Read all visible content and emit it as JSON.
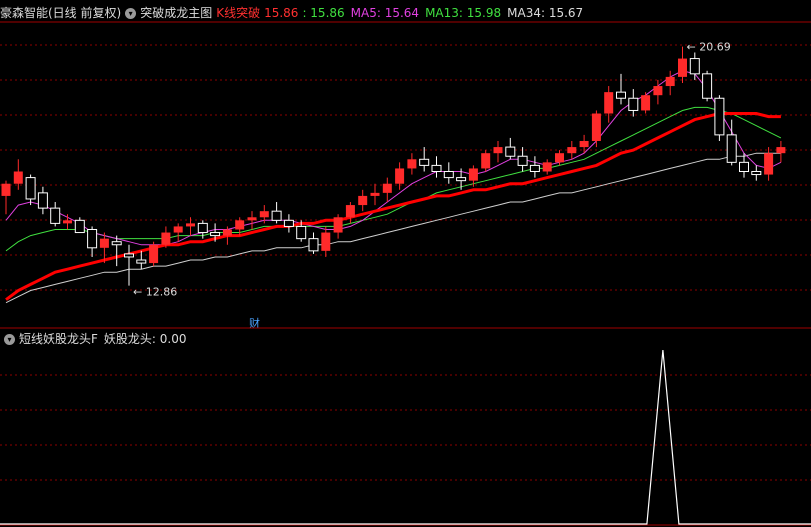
{
  "main_header": {
    "app_prefix": "豪森智能(日线 前复权)",
    "indicator_title": "突破成龙主图",
    "k_label": "K线突破",
    "k_value": "15.86",
    "k_value2": ": 15.86",
    "ma5_label": "MA5: 15.64",
    "ma13_label": "MA13: 15.98",
    "ma34_label": "MA34: 15.67"
  },
  "sub_header": {
    "indicator_title": "短线妖股龙头F",
    "value_label": "妖股龙头: 0.00"
  },
  "annotations": {
    "high": "20.69",
    "low": "12.86",
    "badge": "财"
  },
  "colors": {
    "up": "#ff2a2a",
    "down": "#ffffff",
    "ma5": "#e040e0",
    "ma13": "#40e040",
    "ma34": "#cfcfcf",
    "trend": "#ff0000",
    "grid": "#8b0000"
  },
  "chart_data": {
    "type": "candlestick",
    "candles": [
      [
        15.8,
        16.3,
        15.2,
        16.2
      ],
      [
        16.2,
        17.0,
        16.0,
        16.6
      ],
      [
        16.4,
        16.5,
        15.5,
        15.7
      ],
      [
        15.9,
        16.1,
        15.2,
        15.4
      ],
      [
        15.4,
        15.6,
        14.8,
        14.9
      ],
      [
        14.9,
        15.2,
        14.7,
        15.0
      ],
      [
        15.0,
        15.1,
        14.6,
        14.6
      ],
      [
        14.7,
        14.8,
        13.8,
        14.1
      ],
      [
        14.1,
        14.6,
        13.6,
        14.4
      ],
      [
        14.3,
        14.5,
        13.5,
        14.2
      ],
      [
        13.9,
        14.2,
        12.86,
        13.8
      ],
      [
        13.7,
        14.0,
        13.4,
        13.6
      ],
      [
        13.6,
        14.3,
        13.5,
        14.2
      ],
      [
        14.2,
        14.8,
        14.1,
        14.6
      ],
      [
        14.6,
        14.9,
        14.3,
        14.8
      ],
      [
        14.8,
        15.1,
        14.5,
        14.9
      ],
      [
        14.9,
        15.0,
        14.4,
        14.6
      ],
      [
        14.6,
        14.9,
        14.3,
        14.5
      ],
      [
        14.5,
        14.8,
        14.2,
        14.7
      ],
      [
        14.7,
        15.1,
        14.5,
        15.0
      ],
      [
        15.0,
        15.3,
        14.7,
        15.1
      ],
      [
        15.1,
        15.5,
        14.9,
        15.3
      ],
      [
        15.3,
        15.6,
        14.9,
        15.0
      ],
      [
        15.0,
        15.2,
        14.6,
        14.8
      ],
      [
        14.8,
        15.0,
        14.3,
        14.4
      ],
      [
        14.4,
        14.6,
        13.9,
        14.0
      ],
      [
        14.0,
        14.8,
        13.8,
        14.6
      ],
      [
        14.6,
        15.2,
        14.4,
        15.1
      ],
      [
        15.1,
        15.6,
        14.9,
        15.5
      ],
      [
        15.5,
        16.0,
        15.3,
        15.8
      ],
      [
        15.8,
        16.2,
        15.5,
        15.9
      ],
      [
        15.9,
        16.4,
        15.6,
        16.2
      ],
      [
        16.2,
        16.9,
        16.0,
        16.7
      ],
      [
        16.7,
        17.2,
        16.5,
        17.0
      ],
      [
        17.0,
        17.4,
        16.6,
        16.8
      ],
      [
        16.8,
        17.1,
        16.4,
        16.6
      ],
      [
        16.6,
        16.9,
        16.2,
        16.4
      ],
      [
        16.4,
        16.7,
        16.0,
        16.3
      ],
      [
        16.3,
        16.8,
        16.1,
        16.7
      ],
      [
        16.7,
        17.3,
        16.6,
        17.2
      ],
      [
        17.2,
        17.6,
        16.9,
        17.4
      ],
      [
        17.4,
        17.7,
        17.0,
        17.1
      ],
      [
        17.1,
        17.4,
        16.6,
        16.8
      ],
      [
        16.8,
        17.1,
        16.4,
        16.6
      ],
      [
        16.6,
        17.0,
        16.5,
        16.9
      ],
      [
        16.9,
        17.3,
        16.8,
        17.2
      ],
      [
        17.2,
        17.6,
        17.0,
        17.4
      ],
      [
        17.4,
        17.8,
        17.2,
        17.6
      ],
      [
        17.6,
        18.6,
        17.4,
        18.5
      ],
      [
        18.5,
        19.4,
        18.2,
        19.2
      ],
      [
        19.2,
        19.8,
        18.8,
        19.0
      ],
      [
        19.0,
        19.3,
        18.4,
        18.6
      ],
      [
        18.6,
        19.2,
        18.5,
        19.1
      ],
      [
        19.1,
        19.6,
        18.8,
        19.4
      ],
      [
        19.4,
        19.9,
        19.1,
        19.7
      ],
      [
        19.7,
        20.69,
        19.5,
        20.3
      ],
      [
        20.3,
        20.5,
        19.6,
        19.8
      ],
      [
        19.8,
        19.9,
        18.9,
        19.0
      ],
      [
        19.0,
        19.1,
        17.6,
        17.8
      ],
      [
        17.8,
        18.3,
        16.8,
        16.9
      ],
      [
        16.9,
        17.2,
        16.4,
        16.6
      ],
      [
        16.6,
        16.8,
        16.3,
        16.5
      ],
      [
        16.5,
        17.4,
        16.3,
        17.2
      ],
      [
        17.2,
        17.6,
        16.9,
        17.4
      ]
    ],
    "ma5": [
      15.0,
      15.5,
      15.6,
      15.5,
      15.3,
      15.1,
      14.9,
      14.6,
      14.5,
      14.4,
      14.3,
      14.2,
      14.2,
      14.2,
      14.3,
      14.5,
      14.6,
      14.7,
      14.7,
      14.8,
      14.9,
      15.0,
      15.0,
      15.0,
      14.9,
      14.8,
      14.7,
      14.7,
      14.8,
      15.0,
      15.3,
      15.6,
      15.9,
      16.2,
      16.4,
      16.6,
      16.6,
      16.6,
      16.5,
      16.6,
      16.8,
      17.0,
      17.0,
      16.9,
      16.8,
      16.9,
      17.0,
      17.2,
      17.6,
      18.1,
      18.6,
      18.9,
      19.1,
      19.4,
      19.7,
      19.9,
      19.8,
      19.3,
      18.6,
      17.9,
      17.2,
      16.8,
      16.7,
      16.9
    ],
    "ma13": [
      14.0,
      14.3,
      14.5,
      14.6,
      14.7,
      14.7,
      14.7,
      14.6,
      14.5,
      14.4,
      14.4,
      14.4,
      14.4,
      14.4,
      14.5,
      14.5,
      14.5,
      14.6,
      14.6,
      14.6,
      14.7,
      14.8,
      14.8,
      14.8,
      14.8,
      14.8,
      14.8,
      14.8,
      14.9,
      15.0,
      15.1,
      15.2,
      15.4,
      15.6,
      15.7,
      15.9,
      16.0,
      16.1,
      16.2,
      16.3,
      16.4,
      16.5,
      16.6,
      16.7,
      16.7,
      16.8,
      16.9,
      17.0,
      17.2,
      17.4,
      17.6,
      17.8,
      18.0,
      18.2,
      18.4,
      18.6,
      18.7,
      18.7,
      18.6,
      18.5,
      18.3,
      18.1,
      17.9,
      17.7
    ],
    "ma34": [
      12.3,
      12.5,
      12.7,
      12.8,
      12.9,
      13.0,
      13.1,
      13.2,
      13.3,
      13.3,
      13.4,
      13.4,
      13.5,
      13.5,
      13.6,
      13.7,
      13.7,
      13.8,
      13.8,
      13.9,
      14.0,
      14.0,
      14.1,
      14.1,
      14.1,
      14.2,
      14.2,
      14.3,
      14.3,
      14.4,
      14.5,
      14.6,
      14.7,
      14.8,
      14.9,
      15.0,
      15.1,
      15.2,
      15.3,
      15.4,
      15.5,
      15.6,
      15.6,
      15.7,
      15.8,
      15.9,
      15.9,
      16.0,
      16.1,
      16.2,
      16.3,
      16.4,
      16.5,
      16.6,
      16.7,
      16.8,
      16.9,
      17.0,
      17.0,
      17.1,
      17.1,
      17.2,
      17.2,
      17.2
    ],
    "trend": [
      12.4,
      12.7,
      12.9,
      13.1,
      13.3,
      13.4,
      13.5,
      13.6,
      13.7,
      13.8,
      13.9,
      14.0,
      14.1,
      14.2,
      14.2,
      14.3,
      14.3,
      14.4,
      14.5,
      14.5,
      14.6,
      14.7,
      14.8,
      14.8,
      14.9,
      14.9,
      15.0,
      15.0,
      15.1,
      15.2,
      15.3,
      15.4,
      15.5,
      15.6,
      15.7,
      15.8,
      15.8,
      15.9,
      16.0,
      16.0,
      16.1,
      16.2,
      16.2,
      16.3,
      16.4,
      16.5,
      16.6,
      16.7,
      16.8,
      17.0,
      17.2,
      17.3,
      17.5,
      17.7,
      17.9,
      18.1,
      18.3,
      18.4,
      18.5,
      18.5,
      18.5,
      18.5,
      18.4,
      18.4
    ],
    "sub_values": [
      0,
      0,
      0,
      0,
      0,
      0,
      0,
      0,
      0,
      0,
      0,
      0,
      0,
      0,
      0,
      0,
      0,
      0,
      0,
      0,
      0,
      0,
      0,
      0,
      0,
      0,
      0,
      0,
      0,
      0,
      0,
      0,
      0,
      0,
      0,
      0,
      0,
      0,
      0,
      0,
      0,
      0,
      0,
      0,
      0,
      0,
      0,
      0,
      0,
      0,
      0,
      0,
      0,
      0,
      0,
      0,
      0,
      0,
      0,
      0,
      0,
      0,
      0,
      0
    ],
    "sub_peak": {
      "index": 53,
      "value": 1.0
    }
  }
}
